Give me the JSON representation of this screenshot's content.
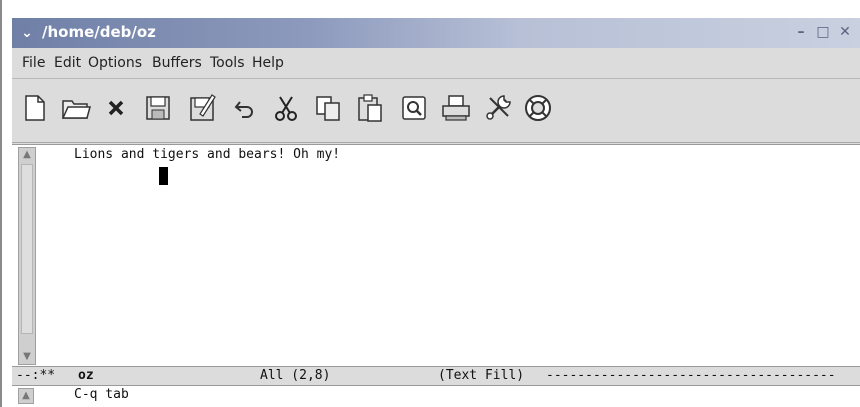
{
  "window": {
    "title": "/home/deb/oz",
    "controls": [
      "minimize-icon",
      "maximize-icon",
      "close-icon"
    ]
  },
  "menubar": {
    "items": [
      "File",
      "Edit",
      "Options",
      "Buffers",
      "Tools",
      "Help"
    ]
  },
  "toolbar": {
    "icons": [
      "new-file-icon",
      "open-folder-icon",
      "close-x-icon",
      "save-icon",
      "save-as-icon",
      "undo-icon",
      "cut-icon",
      "copy-icon",
      "paste-icon",
      "search-icon",
      "print-icon",
      "customize-tools-icon",
      "help-lifebuoy-icon"
    ]
  },
  "editor": {
    "lines": [
      "Lions and tigers and bears! Oh my!"
    ],
    "cursor_position": "line 2, column 8"
  },
  "modeline": {
    "status": "--:**",
    "buffer_name": "oz",
    "position": "All (2,8)",
    "mode": "(Text Fill)",
    "fill": "-------------------------------------"
  },
  "minibuffer": {
    "text": "C-q tab"
  }
}
